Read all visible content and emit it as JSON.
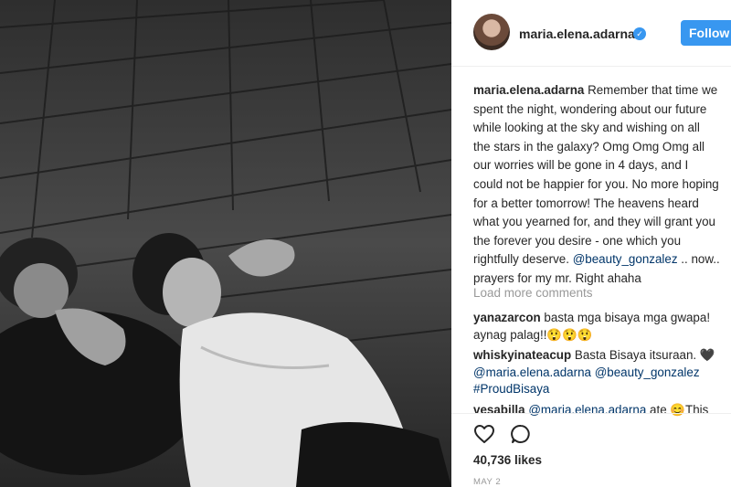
{
  "header": {
    "username": "maria.elena.adarna",
    "follow_label": "Follow"
  },
  "caption": {
    "username": "maria.elena.adarna",
    "text": "Remember that time we spent the night, wondering about our future while looking at the sky and wishing on all the stars in the galaxy? Omg Omg Omg all our worries will be gone in 4 days, and I could not be happier for you. No more hoping for a better tomorrow! The heavens heard what you yearned for, and they will grant you the forever you desire - one which you rightfully deserve.",
    "mention": "@beauty_gonzalez",
    "text_after": ".. now.. prayers for my mr. Right ahaha"
  },
  "load_more_label": "Load more comments",
  "comments": [
    {
      "username": "yanazarcon",
      "text": "basta mga bisaya mga gwapa! aynag palag!!😲😲😲"
    },
    {
      "username": "whiskyinateacup",
      "text": "Basta Bisaya itsuraan. 🖤",
      "mentions": "@maria.elena.adarna @beauty_gonzalez #ProudBisaya"
    },
    {
      "username": "vesabilla",
      "mention": "@maria.elena.adarna",
      "text": "ate 😊This"
    }
  ],
  "actions": {
    "heart_icon": "heart-outline-icon",
    "comment_icon": "comment-bubble-icon"
  },
  "likes": "40,736 likes",
  "date": "MAY 2",
  "colors": {
    "accent": "#3897f0",
    "link": "#003569",
    "muted": "#999999",
    "text": "#262626"
  }
}
